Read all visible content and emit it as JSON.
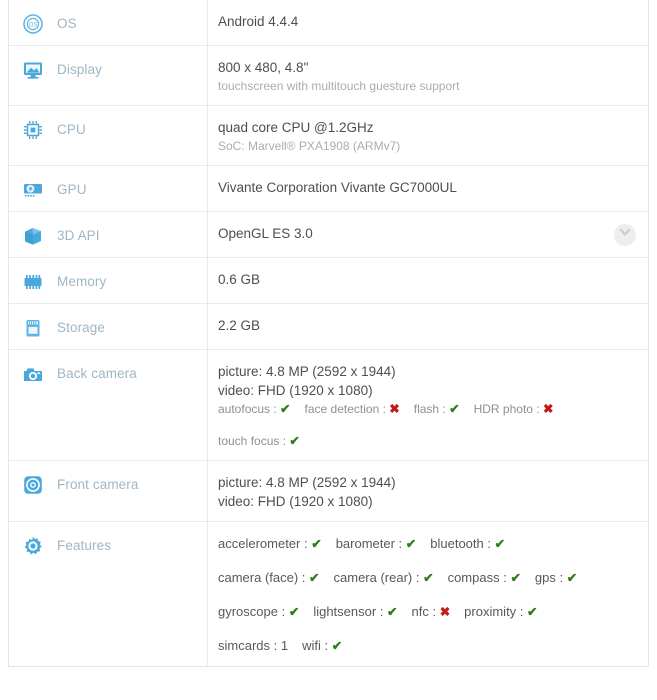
{
  "table": {
    "rows": [
      {
        "key": "os",
        "icon": "os-badge-icon",
        "label": "OS",
        "value_main": "Android 4.4.4",
        "value_sub": ""
      },
      {
        "key": "display",
        "icon": "monitor-icon",
        "label": "Display",
        "value_main": "800 x 480, 4.8\"",
        "value_sub": "touchscreen with multitouch guesture support"
      },
      {
        "key": "cpu",
        "icon": "cpu-chip-icon",
        "label": "CPU",
        "value_main": "quad core CPU @1.2GHz",
        "value_sub": "SoC: Marvell® PXA1908 (ARMv7)"
      },
      {
        "key": "gpu",
        "icon": "gpu-card-icon",
        "label": "GPU",
        "value_main": "Vivante Corporation Vivante GC7000UL",
        "value_sub": ""
      },
      {
        "key": "3dapi",
        "icon": "cube-icon",
        "label": "3D API",
        "value_main": "OpenGL ES 3.0",
        "value_sub": "",
        "expand_icon": "chevron-down-icon"
      },
      {
        "key": "memory",
        "icon": "memory-chip-icon",
        "label": "Memory",
        "value_main": "0.6 GB",
        "value_sub": ""
      },
      {
        "key": "storage",
        "icon": "storage-card-icon",
        "label": "Storage",
        "value_main": "2.2 GB",
        "value_sub": ""
      },
      {
        "key": "back_camera",
        "icon": "camera-back-icon",
        "label": "Back camera",
        "value_main": "picture: 4.8 MP (2592 x 1944)",
        "value_main2": "video: FHD (1920 x 1080)",
        "feature_lines": [
          [
            {
              "name": "autofocus",
              "mark": "yes"
            },
            {
              "name": "face detection",
              "mark": "no"
            },
            {
              "name": "flash",
              "mark": "yes"
            },
            {
              "name": "HDR photo",
              "mark": "no"
            }
          ],
          [
            {
              "name": "touch focus",
              "mark": "yes"
            }
          ]
        ]
      },
      {
        "key": "front_camera",
        "icon": "camera-front-icon",
        "label": "Front camera",
        "value_main": "picture: 4.8 MP (2592 x 1944)",
        "value_main2": "video: FHD (1920 x 1080)"
      },
      {
        "key": "features",
        "icon": "gear-icon",
        "label": "Features",
        "feature_lines_big": [
          [
            {
              "name": "accelerometer",
              "mark": "yes"
            },
            {
              "name": "barometer",
              "mark": "yes"
            },
            {
              "name": "bluetooth",
              "mark": "yes"
            }
          ],
          [
            {
              "name": "camera (face)",
              "mark": "yes"
            },
            {
              "name": "camera (rear)",
              "mark": "yes"
            },
            {
              "name": "compass",
              "mark": "yes"
            },
            {
              "name": "gps",
              "mark": "yes"
            }
          ],
          [
            {
              "name": "gyroscope",
              "mark": "yes"
            },
            {
              "name": "lightsensor",
              "mark": "yes"
            },
            {
              "name": "nfc",
              "mark": "no"
            },
            {
              "name": "proximity",
              "mark": "yes"
            }
          ],
          [
            {
              "name": "simcards",
              "mark": "value",
              "value": "1"
            },
            {
              "name": "wifi",
              "mark": "yes"
            }
          ]
        ]
      }
    ]
  },
  "marks": {
    "yes_glyph": "✔",
    "no_glyph": "✖",
    "separator": ":"
  },
  "colors": {
    "icon_blue": "#4aa8dd",
    "label_blue_gray": "#9fb6c4",
    "value_gray": "#4a4f54",
    "sub_gray": "#a9adb1",
    "check_green": "#2f7d1f",
    "cross_red": "#c21b17",
    "border": "#e8ebed"
  }
}
